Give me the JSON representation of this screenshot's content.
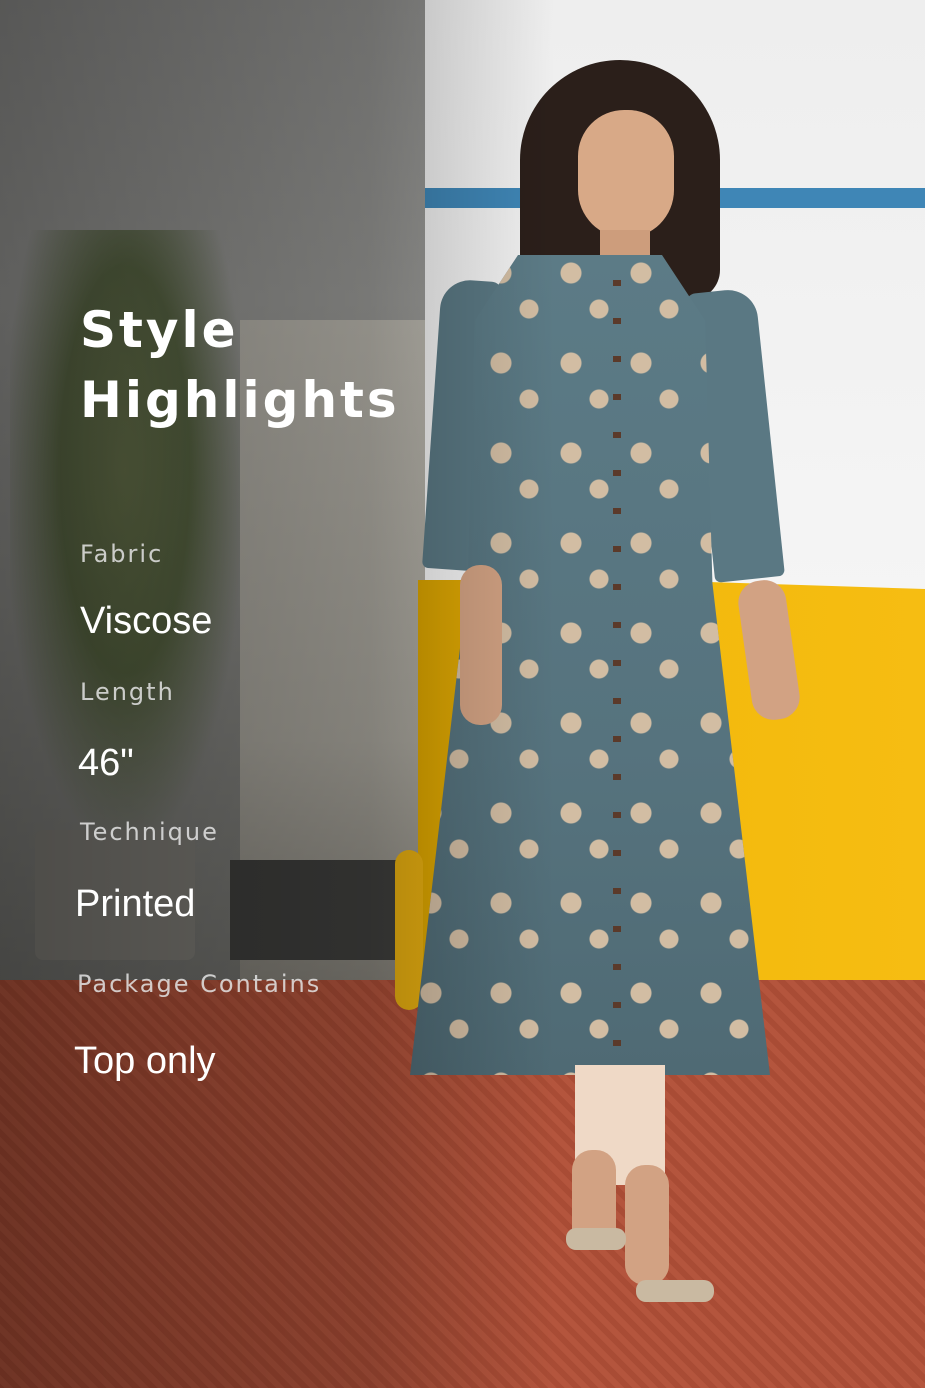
{
  "heading": {
    "line1": "Style",
    "line2": "Highlights"
  },
  "specs": [
    {
      "label": "Fabric",
      "value": "Viscose"
    },
    {
      "label": "Length",
      "value": "46\""
    },
    {
      "label": "Technique",
      "value": "Printed"
    },
    {
      "label": "Package Contains",
      "value": "Top only"
    }
  ]
}
